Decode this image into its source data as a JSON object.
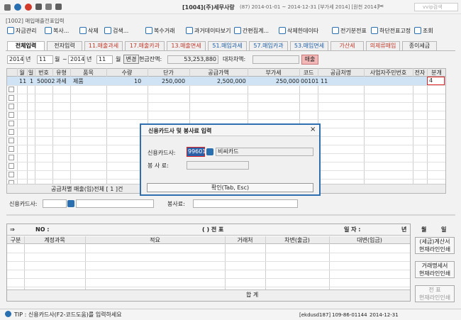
{
  "window": {
    "subtitle": "[1002] 매입매출전표입력",
    "company": "[1004](주)세무사랑",
    "info": "(87) 2014-01-01 ~ 2014-12-31 [부가세 2014] [원천 2014]",
    "search_placeholder": "vvip검색"
  },
  "toolbar": [
    {
      "icon": "close-icon",
      "label": "자금관리"
    },
    {
      "icon": "copy-icon",
      "label": "복사..."
    },
    {
      "icon": "delete-icon",
      "label": "삭제"
    },
    {
      "icon": "search-icon",
      "label": "검색..."
    },
    {
      "icon": "multi-icon",
      "label": "복수거래"
    },
    {
      "icon": "transfer-icon",
      "label": "과거데이타보기"
    },
    {
      "icon": "simple-icon",
      "label": "간편집계..."
    },
    {
      "icon": "delete-data-icon",
      "label": "삭제한데이타"
    },
    {
      "icon": "e-tax-icon",
      "label": "전기분전표"
    },
    {
      "icon": "search-icon",
      "label": "하단전표고정"
    },
    {
      "icon": "view-icon",
      "label": "조회"
    }
  ],
  "tabs": [
    {
      "label": "전체입력",
      "style": "sel"
    },
    {
      "label": "전자입력",
      "style": "dark"
    },
    {
      "label": "11.매출과세",
      "style": "red"
    },
    {
      "label": "17.매출카과",
      "style": "red"
    },
    {
      "label": "13.매출면세",
      "style": "red"
    },
    {
      "label": "51.매입과세",
      "style": "blue"
    },
    {
      "label": "57.매입카과",
      "style": "blue"
    },
    {
      "label": "53.매입면세",
      "style": "blue"
    },
    {
      "label": "가산세",
      "style": "red"
    },
    {
      "label": "의제류매입",
      "style": "red"
    },
    {
      "label": "종이세금",
      "style": "dark"
    }
  ],
  "filter": {
    "year": "2014",
    "year_label": "년",
    "month": "11",
    "month_label": "월",
    "range_sep": "~",
    "year2": "2014",
    "month2": "11",
    "month2_label": "월",
    "change_button": "변경",
    "cash_label": "현금잔액:",
    "cash_value": "53,253,880",
    "balance_label": "대차차액:",
    "sales_button": "매출"
  },
  "grid": {
    "headers": [
      "",
      "월",
      "일",
      "번호",
      "유형",
      "품목",
      "수량",
      "단가",
      "공급가액",
      "부가세",
      "코드",
      "공급처명",
      "사업자주민번호",
      "전자",
      "분개"
    ],
    "row": {
      "month": "11",
      "day": "1",
      "no": "50002",
      "type": "과세",
      "item": "제품",
      "qty": "10",
      "price": "250,000",
      "supply": "2,500,000",
      "vat": "250,000",
      "code": "00101",
      "vendor": "11",
      "bizno": "",
      "elec": "",
      "split": "4"
    },
    "footer": "공급처별 매출(입)전체 [ 1 ]건"
  },
  "mid": {
    "card_label": "신용카드사:",
    "fee_label": "봉사료:"
  },
  "dialog": {
    "title": "신용카드사 및 봉사료 입력",
    "close": "×",
    "card_label": "신용카드사:",
    "card_code": "99601",
    "card_name": "비씨카드",
    "fee_label": "봉 사 료:",
    "confirm": "확인(Tab, Esc)"
  },
  "voucher": {
    "no_label": "NO :",
    "title": "(         )     전     표",
    "date_label": "일     자 :",
    "date_year": "년",
    "date_month": "월",
    "date_day": "일",
    "columns": [
      "구분",
      "계정과목",
      "적요",
      "거래처",
      "차변(출금)",
      "대변(입금)"
    ],
    "total_label": "합     계"
  },
  "side_buttons": [
    {
      "l1": "(세금)계산서",
      "l2": "현재라인인쇄"
    },
    {
      "l1": "거래명세서",
      "l2": "현재라인인쇄"
    },
    {
      "l1": "전     표",
      "l2": "현재라인인쇄"
    }
  ],
  "status": {
    "tip": "TIP : 신용카드사(F2-코드도움)를 입력하세요",
    "user": "[ekdusd187]",
    "bizno": "109-86-01144",
    "date": "2014-12-31"
  }
}
